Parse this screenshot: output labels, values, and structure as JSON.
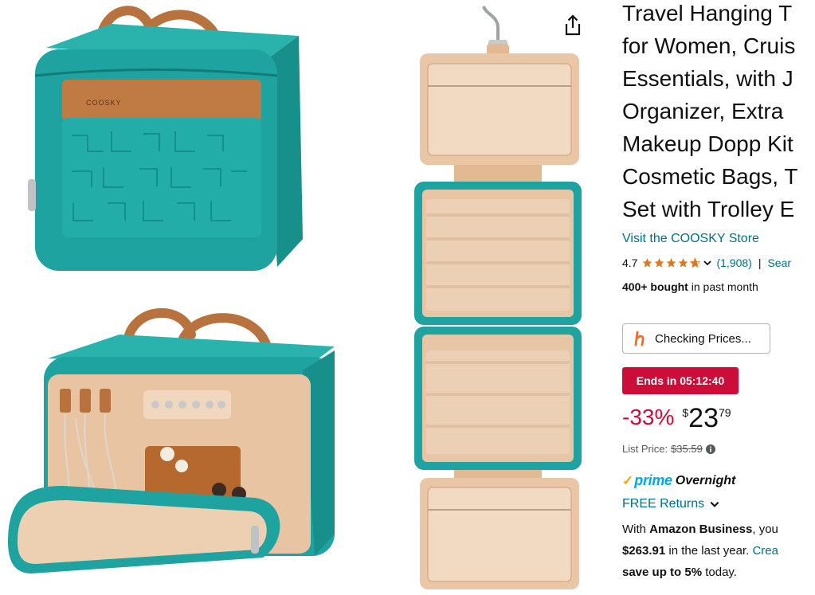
{
  "product": {
    "title_lines": [
      "Travel Hanging T",
      "for Women, Cruis",
      "Essentials, with J",
      "Organizer, Extra",
      "Makeup Dopp Kit",
      "Cosmetic Bags, T",
      "Set with Trolley E"
    ],
    "store_link": "Visit the COOSKY Store",
    "rating_value": "4.7",
    "rating_stars": 4.7,
    "ratings_count": "(1,908)",
    "separator": "|",
    "search_partial": "Sear",
    "bought_bold": "400+ bought",
    "bought_rest": " in past month"
  },
  "buttons": {
    "checking_prices": "Checking Prices..."
  },
  "deal": {
    "badge": "Ends in 05:12:40"
  },
  "price": {
    "discount": "-33%",
    "currency": "$",
    "whole": "23",
    "fraction": "79",
    "list_label": "List Price:",
    "list_value": "$35.59"
  },
  "delivery": {
    "prime_logo": "prime",
    "overnight": "Overnight",
    "free_returns": "FREE Returns"
  },
  "business": {
    "line1_pre": "With ",
    "line1_bold": "Amazon Business",
    "line1_post": ", you",
    "line2_bold": "$263.91",
    "line2_post": " in the last year. ",
    "line2_link": "Crea",
    "line3_bold": "save up to 5%",
    "line3_post": " today."
  },
  "images": {
    "brand_tag": "COOSKY"
  },
  "colors": {
    "teal": "#1fa3a0",
    "leather": "#b8723e",
    "lining": "#e8c4a2",
    "link": "#007185",
    "deal_red": "#cc0c39",
    "star": "#de7921",
    "prime_blue": "#00a8e1"
  },
  "icons": [
    "share-icon",
    "star-icon",
    "chevron-down-icon",
    "honey-h-icon",
    "info-icon",
    "prime-check-icon"
  ]
}
